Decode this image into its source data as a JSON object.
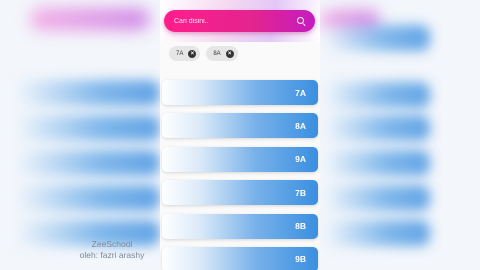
{
  "search": {
    "placeholder": "Cari disini..",
    "icon": "search-icon"
  },
  "chips": [
    {
      "label": "7A"
    },
    {
      "label": "8A"
    }
  ],
  "classes": [
    {
      "label": "7A"
    },
    {
      "label": "8A"
    },
    {
      "label": "9A"
    },
    {
      "label": "7B"
    },
    {
      "label": "8B"
    },
    {
      "label": "9B"
    }
  ],
  "watermark": {
    "line1": "ZeeSchool",
    "line2": "oleh: fazri arashy"
  },
  "colors": {
    "search_gradient_start": "#ff1e8c",
    "search_gradient_end": "#c41cc0",
    "list_item_blue": "#3a8fe0",
    "chip_bg": "#e6e6e6"
  }
}
